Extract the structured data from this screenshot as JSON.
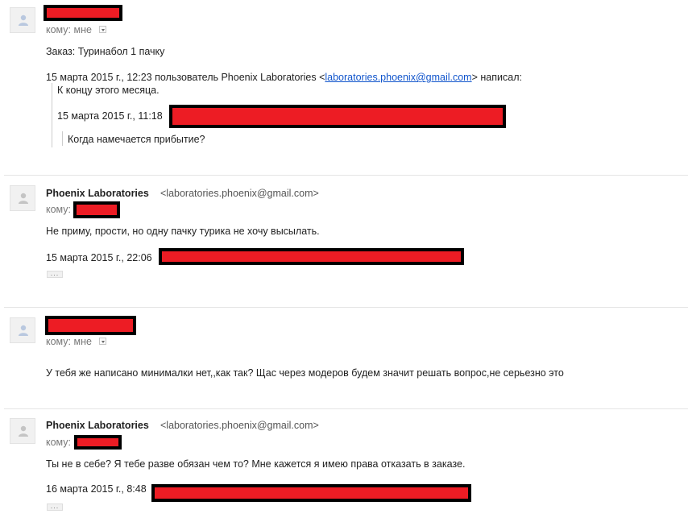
{
  "messages": [
    {
      "recipient_label": "кому: мне",
      "body": "Заказ: Туринабол 1 пачку",
      "quote": {
        "header_prefix": "15 марта 2015 г., 12:23 пользователь Phoenix Laboratories <",
        "header_link": "laboratories.phoenix@gmail.com",
        "header_suffix": "> написал:",
        "text": "К концу этого месяца.",
        "nested_header": "15 марта 2015 г., 11:18",
        "nested_text": "Когда намечается прибытие?"
      }
    },
    {
      "sender_name": "Phoenix Laboratories",
      "sender_email": "<laboratories.phoenix@gmail.com>",
      "recipient_label": "кому:",
      "body": "Не приму, прости, но одну пачку турика не хочу высылать.",
      "quote_header": "15 марта 2015 г., 22:06",
      "show_trimmed": "..."
    },
    {
      "recipient_label": "кому: мне",
      "body": "У тебя же написано минималки нет,,как так? Щас через модеров будем значит решать вопрос,не серьезно это"
    },
    {
      "sender_name": "Phoenix Laboratories",
      "sender_email": "<laboratories.phoenix@gmail.com>",
      "recipient_label": "кому:",
      "body": "Ты не в себе? Я тебе разве обязан чем то? Мне кажется я имею права отказать в заказе.",
      "quote_header": "16 марта 2015 г., 8:48",
      "show_trimmed": "..."
    }
  ],
  "icons": {
    "avatar": "person-silhouette-icon",
    "details": "chevron-down-icon",
    "trimmed": "ellipsis-icon"
  },
  "colors": {
    "redaction_fill": "#ed1c24",
    "redaction_border": "#000000",
    "link": "#1155cc"
  }
}
